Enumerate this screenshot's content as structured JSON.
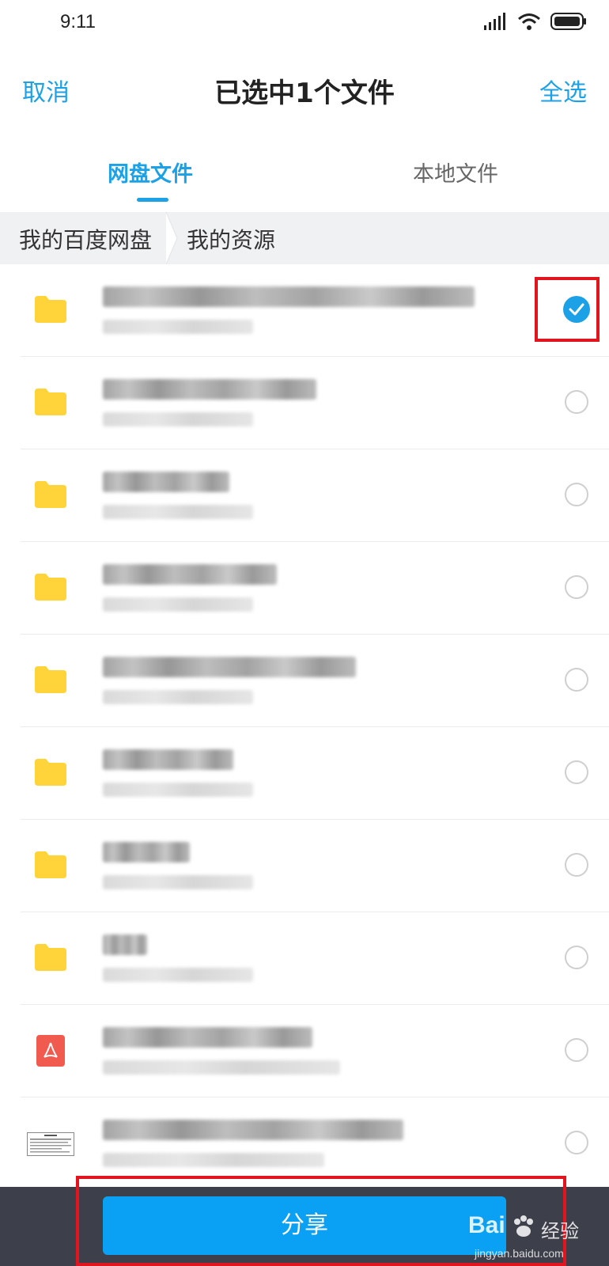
{
  "status_bar": {
    "time": "9:11"
  },
  "header": {
    "cancel_label": "取消",
    "title": "已选中1个文件",
    "select_all_label": "全选"
  },
  "tabs": [
    {
      "label": "网盘文件",
      "active": true
    },
    {
      "label": "本地文件",
      "active": false
    }
  ],
  "breadcrumb": [
    "我的百度网盘",
    "我的资源"
  ],
  "files": [
    {
      "type": "folder",
      "checked": true
    },
    {
      "type": "folder",
      "checked": false
    },
    {
      "type": "folder",
      "checked": false
    },
    {
      "type": "folder",
      "checked": false
    },
    {
      "type": "folder",
      "checked": false
    },
    {
      "type": "folder",
      "checked": false
    },
    {
      "type": "folder",
      "checked": false
    },
    {
      "type": "folder",
      "checked": false
    },
    {
      "type": "pdf",
      "checked": false
    },
    {
      "type": "document",
      "checked": false
    }
  ],
  "bottom_bar": {
    "share_label": "分享"
  },
  "watermark": {
    "brand": "Bai",
    "text": "经验",
    "url": "jingyan.baidu.com"
  },
  "colors": {
    "accent": "#1da1e6",
    "share_button": "#0aa1f4",
    "folder": "#ffd43b",
    "pdf": "#f05a4f",
    "highlight": "#e0151e",
    "bottom_bar": "#3d404a"
  }
}
